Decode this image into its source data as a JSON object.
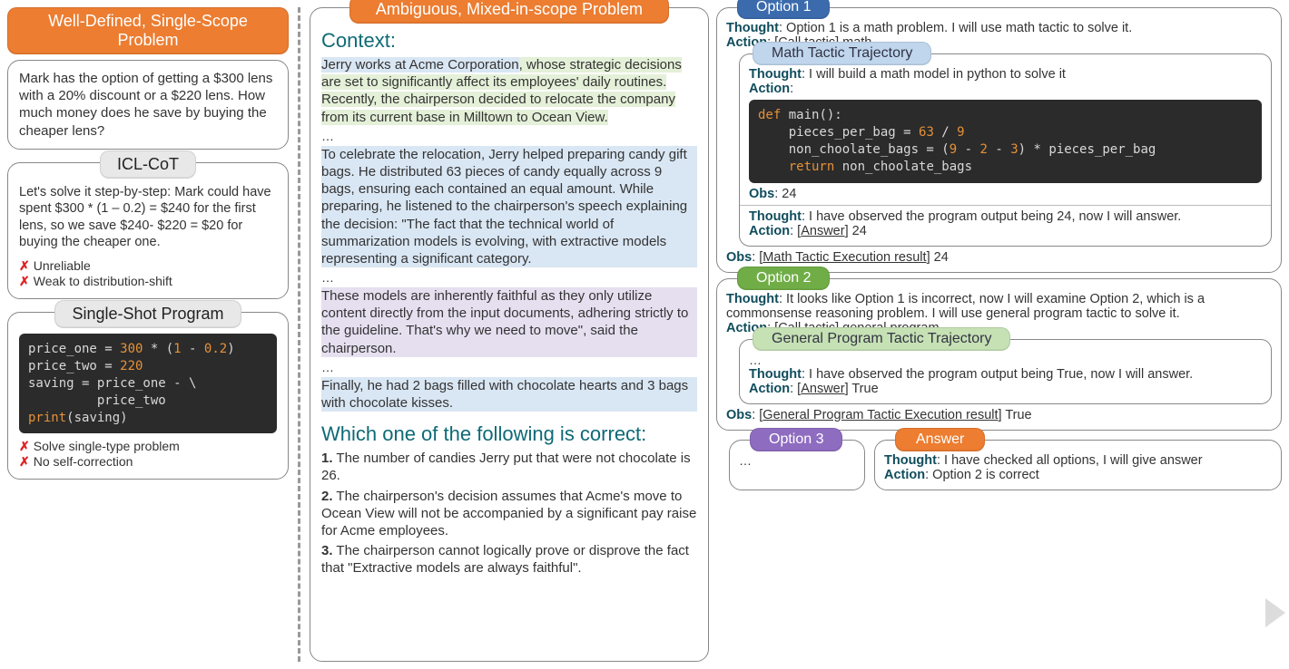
{
  "left": {
    "header": "Well-Defined, Single-Scope Problem",
    "problem": "Mark has the option of getting a $300 lens with a 20% discount or a $220 lens.  How much money does he save by buying the cheaper lens?",
    "icl": {
      "title": "ICL-CoT",
      "body": "Let's solve it step-by-step: Mark could have spent $300 * (1 – 0.2) = $240 for the first lens, so we save $240- $220 = $20 for buying the cheaper one.",
      "neg1": "Unreliable",
      "neg2": "Weak to distribution-shift"
    },
    "ssp": {
      "title": "Single-Shot Program",
      "code": "price_one = 300 * (1 - 0.2)\nprice_two = 220\nsaving = price_one - \\\n         price_two\nprint(saving)",
      "neg1": "Solve single-type problem",
      "neg2": "No self-correction"
    }
  },
  "mid": {
    "header": "Ambiguous, Mixed-in-scope Problem",
    "contextLabel": "Context",
    "p1a": "Jerry works at Acme Corporation",
    "p1b": ", whose strategic decisions are set to significantly affect its employees' daily routines. Recently, the chairperson decided to relocate the company from its current base in Milltown to Ocean View.",
    "p2": "To celebrate the relocation, Jerry helped preparing candy gift bags. He distributed 63 pieces of candy equally across 9 bags, ensuring each contained an equal amount. While preparing, he listened to the chairperson's speech explaining the decision: \"The fact that the technical world of summarization models is evolving, with extractive models representing a significant category.",
    "p3": "These models are inherently faithful as they only utilize content directly from the input documents, adhering strictly to the guideline. That's why we need to move\", said the chairperson.",
    "p4": "Finally, he had 2 bags filled with chocolate hearts and 3 bags with chocolate kisses.",
    "questionLabel": "Which one of the following is correct",
    "opt1": "The number of candies Jerry put that were not chocolate is 26.",
    "opt2": "The chairperson's decision assumes that Acme's move to Ocean View will not be accompanied by a significant pay raise for Acme employees.",
    "opt3": "The chairperson cannot logically prove or disprove the fact that \"Extractive models are always faithful\".",
    "n1": "1.",
    "n2": "2.",
    "n3": "3."
  },
  "right": {
    "opt1": {
      "label": "Option 1",
      "thought": "Option 1 is a math problem. I will use math tactic to solve it.",
      "callTactic": "Call tactic",
      "callArg": "math",
      "inner": {
        "label": "Math Tactic Trajectory",
        "thought1": "I will build a math model in python to solve it",
        "code": "def main():\n    pieces_per_bag = 63 / 9\n    non_choolate_bags = (9 - 2 - 3) * pieces_per_bag\n    return non_choolate_bags",
        "obs1": "24",
        "thought2": "I have observed the program output being 24, now I will answer.",
        "answerKw": "Answer",
        "answerVal": "24"
      },
      "obsOuterLabel": "Math Tactic Execution result",
      "obsOuterVal": "24"
    },
    "opt2": {
      "label": "Option 2",
      "thought": "It looks like Option 1 is incorrect, now I will examine Option 2, which is a commonsense reasoning problem. I will use general program tactic to solve it.",
      "callTactic": "Call tactic",
      "callArg": "general program",
      "inner": {
        "label": "General Program Tactic Trajectory",
        "thought": "I have observed the program output being True, now I will answer.",
        "answerKw": "Answer",
        "answerVal": "True"
      },
      "obsOuterLabel": "General Program Tactic Execution result",
      "obsOuterVal": "True"
    },
    "opt3": {
      "label": "Option 3",
      "body": "…"
    },
    "answer": {
      "label": "Answer",
      "thought": "I have checked all options, I will give answer",
      "action": "Option 2 is correct"
    },
    "kw": {
      "thought": "Thought",
      "action": "Action",
      "obs": "Obs"
    },
    "ell": "…"
  }
}
